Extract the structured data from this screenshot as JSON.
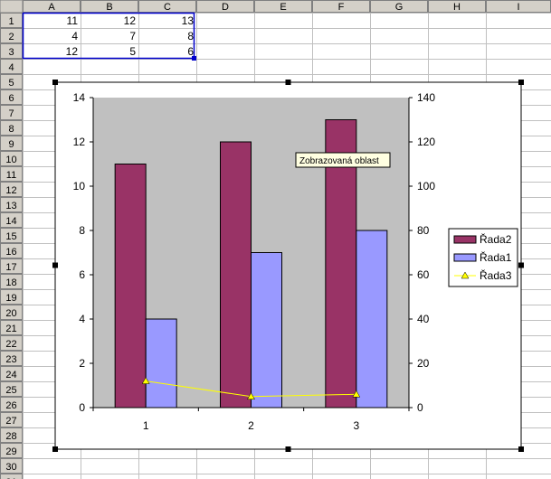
{
  "spreadsheet": {
    "columns": [
      "A",
      "B",
      "C",
      "D",
      "E",
      "F",
      "G",
      "H",
      "I"
    ],
    "rows": [
      "1",
      "2",
      "3",
      "4",
      "5",
      "6",
      "7",
      "8",
      "9",
      "10",
      "11",
      "12",
      "13",
      "14",
      "15",
      "16",
      "17",
      "18",
      "19",
      "20",
      "21",
      "22",
      "23",
      "24",
      "25",
      "26",
      "27",
      "28",
      "29",
      "30",
      "31"
    ],
    "cells": [
      [
        "11",
        "12",
        "13"
      ],
      [
        "4",
        "7",
        "8"
      ],
      [
        "12",
        "5",
        "6"
      ]
    ]
  },
  "tooltip": {
    "text": "Zobrazovaná oblast"
  },
  "chart_data": {
    "type": "bar",
    "title": "",
    "xlabel": "",
    "ylabel": "",
    "categories": [
      "1",
      "2",
      "3"
    ],
    "left_axis": {
      "ylim": [
        0,
        14
      ],
      "ticks": [
        "0",
        "2",
        "4",
        "6",
        "8",
        "10",
        "12",
        "14"
      ]
    },
    "right_axis": {
      "ylim": [
        0,
        140
      ],
      "ticks": [
        "0",
        "20",
        "40",
        "60",
        "80",
        "100",
        "120",
        "140"
      ]
    },
    "series": [
      {
        "name": "Řada2",
        "type": "bar",
        "axis": "left",
        "values": [
          11,
          12,
          13
        ],
        "color": "#993366"
      },
      {
        "name": "Řada1",
        "type": "bar",
        "axis": "right",
        "values": [
          40,
          70,
          80
        ],
        "color": "#9999ff"
      },
      {
        "name": "Řada3",
        "type": "line",
        "axis": "right",
        "values": [
          12,
          5,
          6
        ],
        "color": "#ffff00"
      }
    ],
    "plot_background": "#c0c0c0",
    "grid": false,
    "legend_position": "right"
  },
  "colors": {
    "header_bg": "#d4d0c8",
    "grid_line": "#c0c0c0",
    "selection_border": "#0000cc",
    "tooltip_bg": "#ffffe1"
  }
}
